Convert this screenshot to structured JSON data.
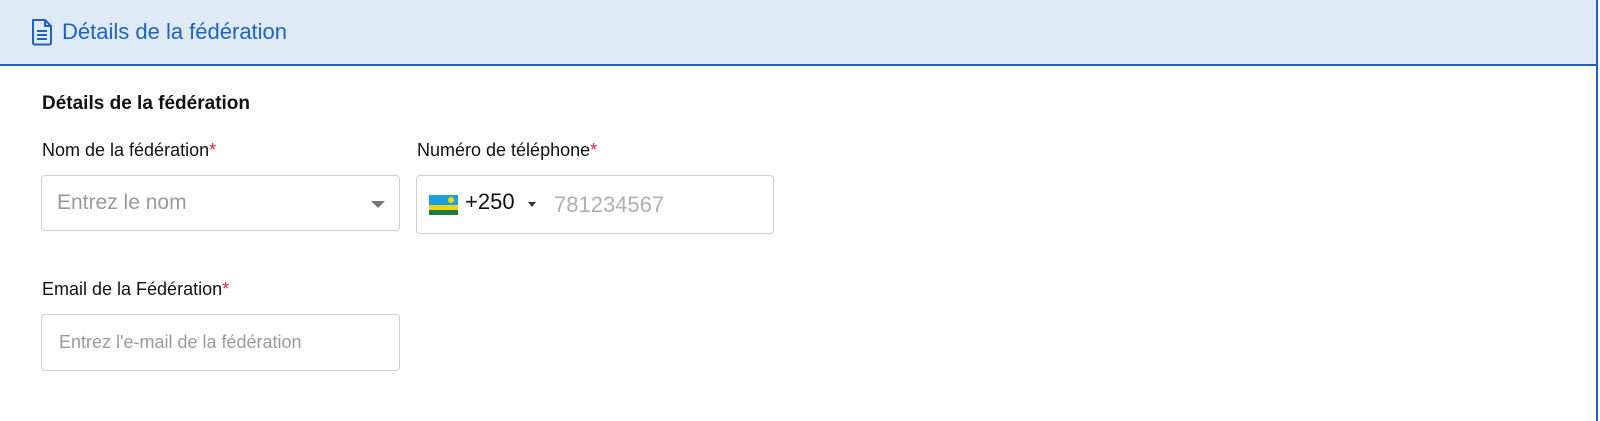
{
  "header": {
    "title": "Détails de la fédération",
    "icon": "document-icon"
  },
  "section": {
    "title": "Détails de la fédération"
  },
  "form": {
    "name_label": "Nom de la fédération",
    "name_placeholder": "Entrez le nom",
    "phone_label": "Numéro de téléphone",
    "phone_country_flag": "rwanda-flag-icon",
    "phone_dial_code": "+250",
    "phone_placeholder": "781234567",
    "email_label": "Email de la Fédération",
    "email_placeholder": "Entrez l'e-mail de la fédération",
    "required_marker": "*"
  },
  "colors": {
    "accent": "#1f62c4",
    "header_bg": "#deebf7",
    "required": "#e0253b"
  }
}
